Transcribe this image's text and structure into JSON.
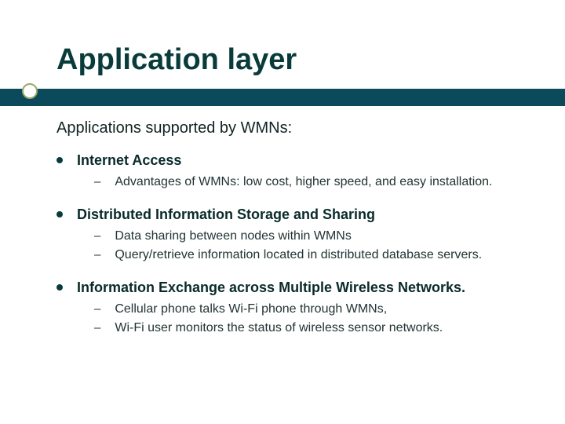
{
  "title": "Application layer",
  "subtitle": "Applications supported by WMNs:",
  "bullets": [
    {
      "label": "Internet Access",
      "subs": [
        "Advantages of WMNs: low cost, higher speed, and easy installation."
      ]
    },
    {
      "label": "Distributed Information Storage and Sharing",
      "subs": [
        "Data sharing between nodes within WMNs",
        "Query/retrieve information located in distributed database servers."
      ]
    },
    {
      "label": "Information Exchange across Multiple Wireless Networks.",
      "subs": [
        "Cellular phone talks Wi-Fi phone through WMNs,",
        "Wi-Fi user monitors the status of wireless sensor networks."
      ]
    }
  ]
}
